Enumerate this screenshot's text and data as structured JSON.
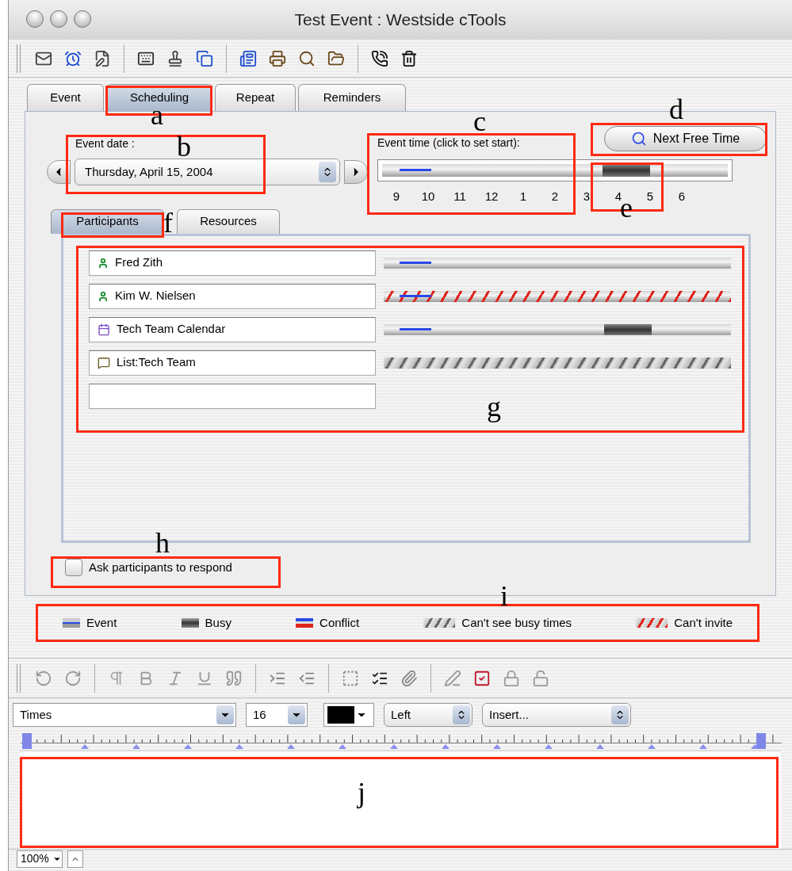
{
  "window": {
    "title": "Test Event : Westside cTools"
  },
  "tabs": [
    {
      "label": "Event",
      "selected": false
    },
    {
      "label": "Scheduling",
      "selected": true
    },
    {
      "label": "Repeat",
      "selected": false
    },
    {
      "label": "Reminders",
      "selected": false
    }
  ],
  "event_date": {
    "label": "Event date :",
    "value": "Thursday, April 15, 2004"
  },
  "event_time": {
    "label": "Event time (click to set start):",
    "ticks": [
      "9",
      "10",
      "11",
      "12",
      "1",
      "2",
      "3",
      "4",
      "5",
      "6"
    ]
  },
  "next_free_time_button": "Next Free Time",
  "subtabs": [
    {
      "label": "Participants",
      "selected": true
    },
    {
      "label": "Resources",
      "selected": false
    }
  ],
  "participants": [
    {
      "name": "Fred Zith",
      "kind": "person",
      "cant_invite": false,
      "cant_see": false,
      "event": true,
      "busy": false
    },
    {
      "name": "Kim W. Nielsen",
      "kind": "person",
      "cant_invite": true,
      "cant_see": false,
      "event": true,
      "busy": false
    },
    {
      "name": "Tech Team Calendar",
      "kind": "calendar",
      "cant_invite": false,
      "cant_see": false,
      "event": true,
      "busy": true
    },
    {
      "name": "List:Tech Team",
      "kind": "list",
      "cant_invite": false,
      "cant_see": true,
      "event": false,
      "busy": false
    }
  ],
  "ask_to_respond": {
    "label": "Ask participants to respond",
    "checked": false
  },
  "legend": [
    {
      "kind": "event",
      "label": "Event"
    },
    {
      "kind": "busy",
      "label": "Busy"
    },
    {
      "kind": "conflict",
      "label": "Conflict"
    },
    {
      "kind": "cant_see",
      "label": "Can't see busy times"
    },
    {
      "kind": "cant_invite",
      "label": "Can't invite"
    }
  ],
  "format_bar": {
    "font": "Times",
    "size": "16",
    "align": "Left",
    "insert": "Insert..."
  },
  "status_bar": {
    "zoom": "100%"
  },
  "annotations": [
    {
      "label": "a"
    },
    {
      "label": "b"
    },
    {
      "label": "c"
    },
    {
      "label": "d"
    },
    {
      "label": "e"
    },
    {
      "label": "f"
    },
    {
      "label": "g"
    },
    {
      "label": "h"
    },
    {
      "label": "i"
    },
    {
      "label": "j"
    }
  ]
}
